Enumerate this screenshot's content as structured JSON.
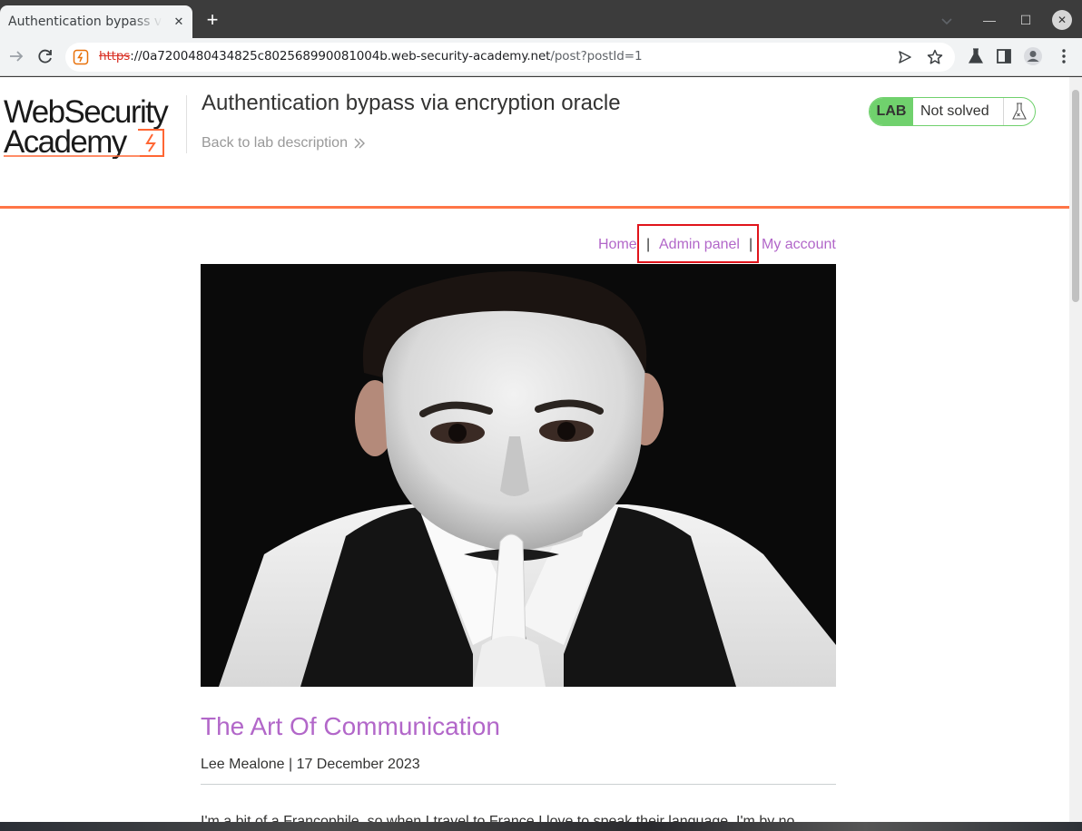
{
  "browser": {
    "tab_title": "Authentication bypass via encryption oracle",
    "url_scheme": "https",
    "url_host": "://0a7200480434825c802568990081004b.web-security-academy.net",
    "url_path": "/post?postId=1"
  },
  "header": {
    "logo_line1": "WebSecurity",
    "logo_line2": "Academy",
    "lab_title": "Authentication bypass via encryption oracle",
    "back_link": "Back to lab description",
    "lab_label": "LAB",
    "lab_status": "Not solved"
  },
  "nav": {
    "home": "Home",
    "separator": "|",
    "admin_panel": "Admin panel",
    "my_account": "My account"
  },
  "post": {
    "title": "The Art Of Communication",
    "meta": "Lee Mealone | 17 December 2023",
    "body_first_line": "I'm a bit of a Francophile, so when I travel to France I love to speak their language. I'm by no"
  },
  "colors": {
    "accent_purple": "#b267c9",
    "accent_orange": "#ff6633",
    "lab_green": "#70d16d",
    "highlight_red": "#e0141b"
  }
}
